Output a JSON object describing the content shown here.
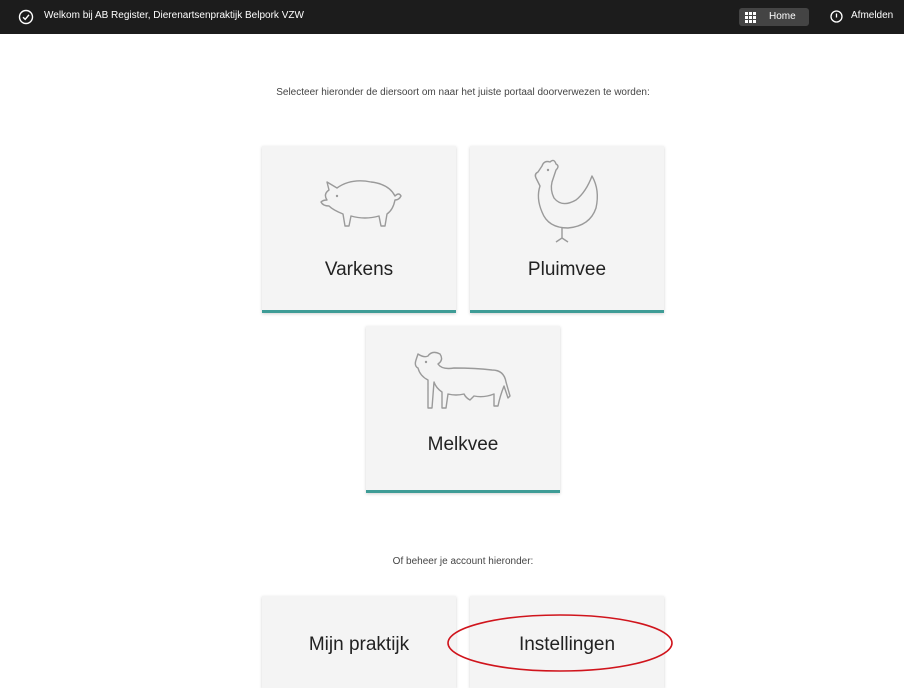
{
  "topbar": {
    "welcome": "Welkom bij AB Register, Dierenartsenpraktijk Belpork VZW",
    "home_label": "Home",
    "logout_label": "Afmelden"
  },
  "main": {
    "intro": "Selecteer hieronder de diersoort om naar het juiste portaal doorverwezen te worden:",
    "species": [
      {
        "label": "Varkens",
        "icon": "pig-icon"
      },
      {
        "label": "Pluimvee",
        "icon": "chicken-icon"
      },
      {
        "label": "Melkvee",
        "icon": "cow-icon"
      }
    ],
    "account_intro": "Of beheer je account hieronder:",
    "account_tiles": [
      {
        "label": "Mijn praktijk"
      },
      {
        "label": "Instellingen"
      }
    ]
  },
  "colors": {
    "topbar_bg": "#1c1c1c",
    "accent": "#3e9c96",
    "annotation": "#d0141c"
  }
}
